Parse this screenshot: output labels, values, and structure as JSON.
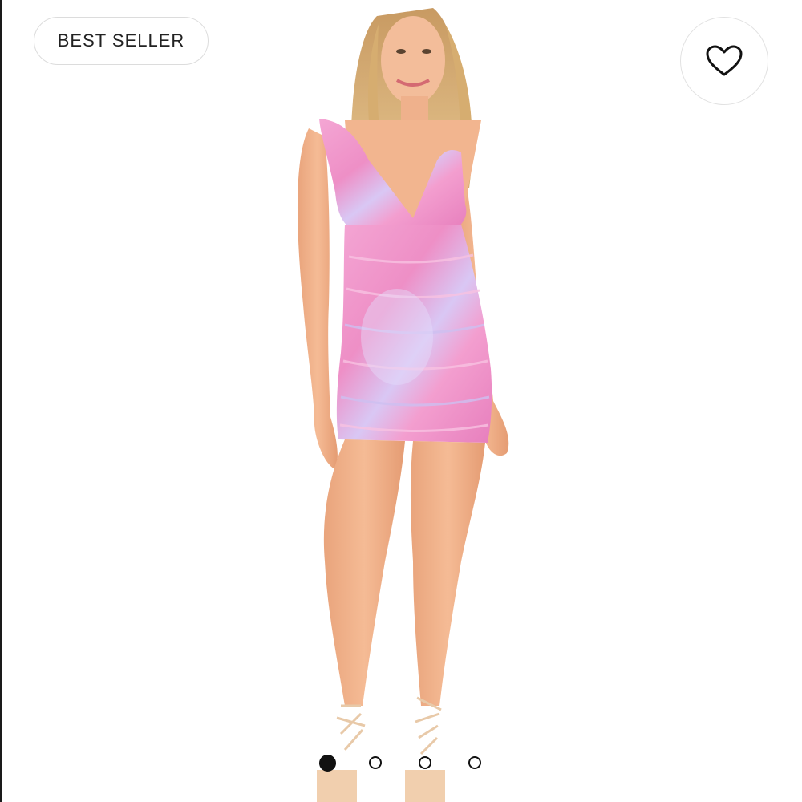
{
  "badge": {
    "label": "BEST SELLER"
  },
  "favorite": {
    "icon": "heart-outline-icon"
  },
  "carousel": {
    "total_slides": 4,
    "active_index": 0
  },
  "colors": {
    "dress": "#ee8fc6",
    "dress_highlight": "#c9c4f2",
    "skin": "#f2b48e",
    "hair": "#d8b27c",
    "dot": "#111111"
  }
}
